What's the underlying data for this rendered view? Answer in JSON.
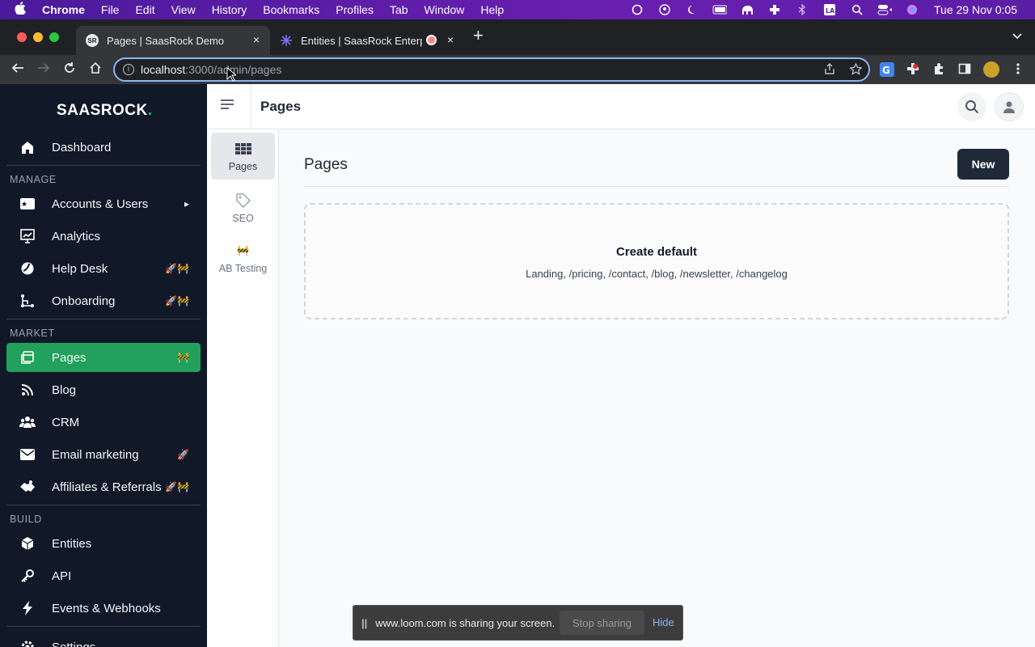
{
  "menubar": {
    "apple": "",
    "app": "Chrome",
    "items": [
      "File",
      "Edit",
      "View",
      "History",
      "Bookmarks",
      "Profiles",
      "Tab",
      "Window",
      "Help"
    ],
    "clock": "Tue 29 Nov  0:05"
  },
  "browser": {
    "tabs": [
      {
        "title": "Pages | SaasRock Demo",
        "favicon": "SR"
      },
      {
        "title": "Entities | SaasRock Enterpr",
        "favicon": ""
      }
    ],
    "url_host": "localhost",
    "url_rest": ":3000/admin/pages"
  },
  "sidebar": {
    "logo": "SAASROCK",
    "logo_dot": ".",
    "sections": {
      "manage": "MANAGE",
      "market": "MARKET",
      "build": "BUILD"
    },
    "items": [
      {
        "label": "Dashboard",
        "icon": "house-icon",
        "badge": ""
      },
      {
        "label": "Accounts & Users",
        "icon": "id-card-icon",
        "badge": "▸"
      },
      {
        "label": "Analytics",
        "icon": "chart-icon",
        "badge": ""
      },
      {
        "label": "Help Desk",
        "icon": "help-desk-icon",
        "badge": "🚀🚧"
      },
      {
        "label": "Onboarding",
        "icon": "onboarding-icon",
        "badge": "🚀🚧"
      },
      {
        "label": "Pages",
        "icon": "pages-icon",
        "badge": "🚧"
      },
      {
        "label": "Blog",
        "icon": "rss-icon",
        "badge": ""
      },
      {
        "label": "CRM",
        "icon": "users-icon",
        "badge": ""
      },
      {
        "label": "Email marketing",
        "icon": "mail-icon",
        "badge": "🚀"
      },
      {
        "label": "Affiliates & Referrals",
        "icon": "handshake-icon",
        "badge": "🚀🚧"
      },
      {
        "label": "Entities",
        "icon": "cube-icon",
        "badge": ""
      },
      {
        "label": "API",
        "icon": "key-icon",
        "badge": ""
      },
      {
        "label": "Events & Webhooks",
        "icon": "bolt-icon",
        "badge": ""
      },
      {
        "label": "Settings",
        "icon": "gear-icon",
        "badge": ""
      }
    ]
  },
  "topbar": {
    "title": "Pages"
  },
  "subnav": [
    {
      "label": "Pages",
      "icon": "grid-icon"
    },
    {
      "label": "SEO",
      "icon": "tag-icon"
    },
    {
      "label": "AB Testing",
      "icon": "construction-icon",
      "emoji": "🚧"
    }
  ],
  "main": {
    "heading": "Pages",
    "new_label": "New",
    "empty_title": "Create default",
    "empty_subtitle": "Landing, /pricing, /contact, /blog, /newsletter, /changelog"
  },
  "share_bar": {
    "pause": "||",
    "message": "www.loom.com is sharing your screen.",
    "stop_label": "Stop sharing",
    "hide_label": "Hide"
  }
}
